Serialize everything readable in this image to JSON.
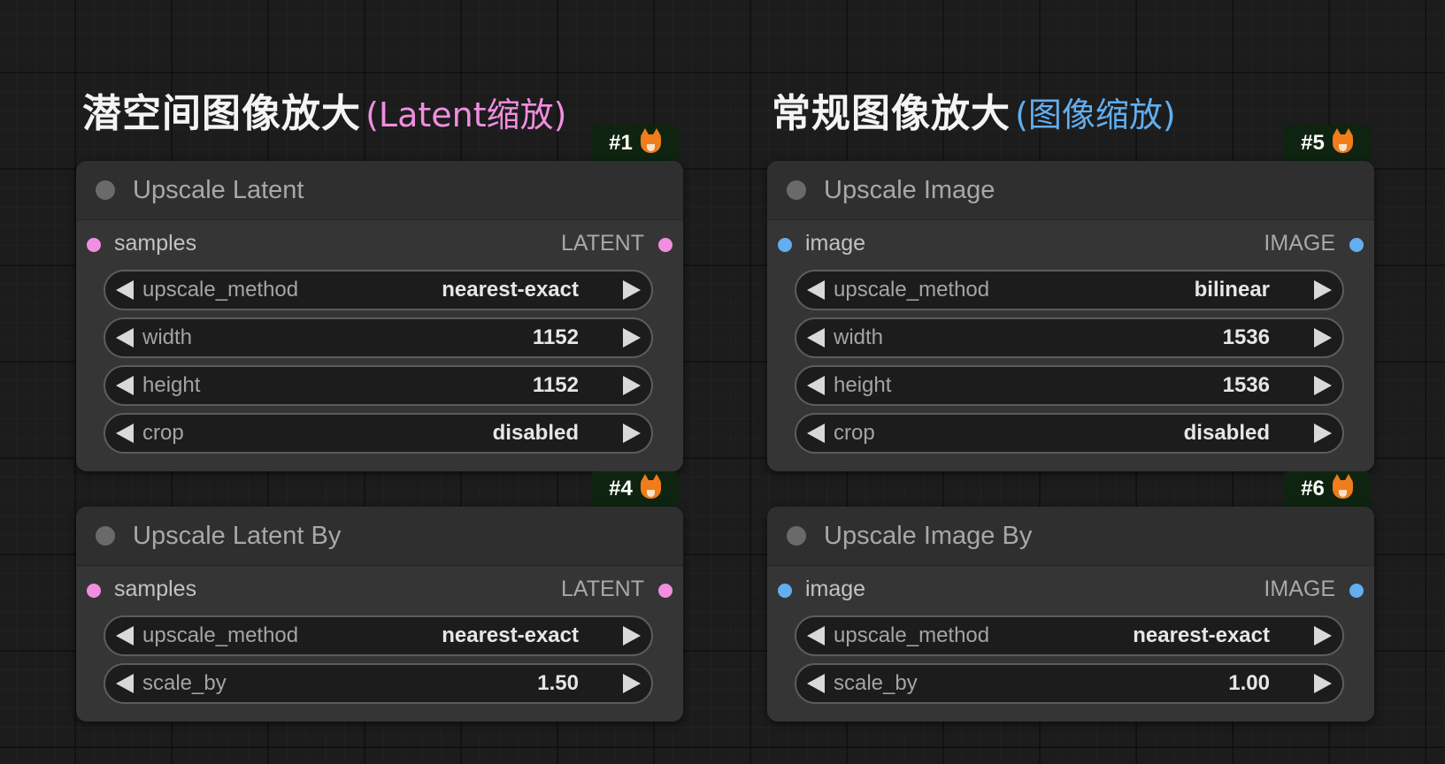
{
  "left": {
    "heading": "潜空间图像放大",
    "heading_sub": "(Latent缩放)",
    "nodes": [
      {
        "badge": "#1",
        "title": "Upscale Latent",
        "input_label": "samples",
        "output_type": "LATENT",
        "widgets": [
          {
            "label": "upscale_method",
            "value": "nearest-exact"
          },
          {
            "label": "width",
            "value": "1152"
          },
          {
            "label": "height",
            "value": "1152"
          },
          {
            "label": "crop",
            "value": "disabled"
          }
        ]
      },
      {
        "badge": "#4",
        "title": "Upscale Latent By",
        "input_label": "samples",
        "output_type": "LATENT",
        "widgets": [
          {
            "label": "upscale_method",
            "value": "nearest-exact"
          },
          {
            "label": "scale_by",
            "value": "1.50"
          }
        ]
      }
    ]
  },
  "right": {
    "heading": "常规图像放大",
    "heading_sub": "(图像缩放)",
    "nodes": [
      {
        "badge": "#5",
        "title": "Upscale Image",
        "input_label": "image",
        "output_type": "IMAGE",
        "widgets": [
          {
            "label": "upscale_method",
            "value": "bilinear"
          },
          {
            "label": "width",
            "value": "1536"
          },
          {
            "label": "height",
            "value": "1536"
          },
          {
            "label": "crop",
            "value": "disabled"
          }
        ]
      },
      {
        "badge": "#6",
        "title": "Upscale Image By",
        "input_label": "image",
        "output_type": "IMAGE",
        "widgets": [
          {
            "label": "upscale_method",
            "value": "nearest-exact"
          },
          {
            "label": "scale_by",
            "value": "1.00"
          }
        ]
      }
    ]
  },
  "colors": {
    "latent_slot": "#f08ee0",
    "image_slot": "#62aef0",
    "badge_bg": "#0e2410",
    "node_bg": "#353535",
    "canvas_bg": "#1c1c1c"
  },
  "icons": {
    "badge": "fox-icon",
    "widget_decrement": "arrow-left-icon",
    "widget_increment": "arrow-right-icon"
  }
}
